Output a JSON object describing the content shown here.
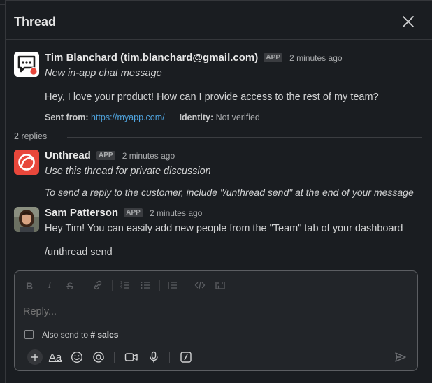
{
  "header": {
    "title": "Thread"
  },
  "messages": [
    {
      "name": "Tim Blanchard (tim.blanchard@gmail.com)",
      "badge": "APP",
      "time": "2 minutes ago",
      "subtitle": "New in-app chat message",
      "body": "Hey, I love your product! How can I provide access to the rest of my team?",
      "meta": {
        "sent_from_label": "Sent from:",
        "sent_from_link": "https://myapp.com/",
        "identity_label": "Identity:",
        "identity_value": "Not verified"
      }
    },
    {
      "name": "Unthread",
      "badge": "APP",
      "time": "2 minutes ago",
      "line1": "Use this thread for private discussion",
      "line2": "To send a reply to the customer, include \"/unthread send\" at the end of your message"
    },
    {
      "name": "Sam Patterson",
      "badge": "APP",
      "time": "2 minutes ago",
      "line1": "Hey Tim! You can easily add new people from the \"Team\" tab of your dashboard",
      "line2": "/unthread send"
    }
  ],
  "replies": {
    "label": "2 replies"
  },
  "composer": {
    "placeholder": "Reply...",
    "also_send_label": "Also send to",
    "channel": "# sales",
    "format_icons": [
      "bold-icon",
      "italic-icon",
      "strikethrough-icon",
      "link-icon",
      "ordered-list-icon",
      "bulleted-list-icon",
      "indent-list-icon",
      "code-icon",
      "code-block-icon"
    ],
    "bottom_icons": [
      "plus-icon",
      "text-format-icon",
      "emoji-icon",
      "mention-icon",
      "video-icon",
      "microphone-icon",
      "slash-command-icon",
      "send-icon"
    ],
    "text_format_label": "Aa"
  },
  "colors": {
    "background": "#1a1d21",
    "link": "#4fa3dd",
    "unthread_brand": "#e8473b"
  }
}
